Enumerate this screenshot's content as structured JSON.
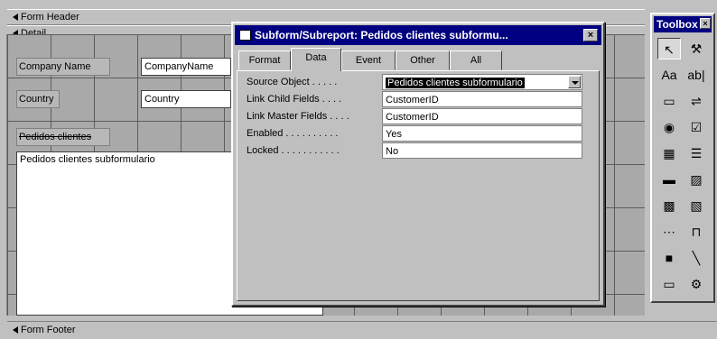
{
  "designer": {
    "form_header": "Form Header",
    "detail": "Detail",
    "form_footer": "Form Footer",
    "controls": {
      "company_label": "Company Name",
      "company_field": "CompanyName",
      "country_label": "Country",
      "country_field": "Country",
      "subform_label": "Pedidos clientes",
      "subform_text": "Pedidos clientes subformulario"
    }
  },
  "dialog": {
    "title": "Subform/Subreport: Pedidos clientes subformu...",
    "close_glyph": "×",
    "tabs": [
      {
        "label": "Format",
        "active": false
      },
      {
        "label": "Data",
        "active": true
      },
      {
        "label": "Event",
        "active": false
      },
      {
        "label": "Other",
        "active": false
      },
      {
        "label": "All",
        "active": false
      }
    ],
    "properties": [
      {
        "label": "Source Object . . . . .",
        "value": "Pedidos clientes subformulario"
      },
      {
        "label": "Link Child Fields . . . .",
        "value": "CustomerID"
      },
      {
        "label": "Link Master Fields . . . .",
        "value": "CustomerID"
      },
      {
        "label": "Enabled . . . . . . . . . .",
        "value": "Yes"
      },
      {
        "label": "Locked . . . . . . . . . . .",
        "value": "No"
      }
    ]
  },
  "toolbox": {
    "title": "Toolbox",
    "close_glyph": "×",
    "buttons": [
      {
        "icon": "select-objects-icon",
        "glyph": "↖"
      },
      {
        "icon": "control-wizards-icon",
        "glyph": "⚒"
      },
      {
        "icon": "label-icon",
        "glyph": "Aa"
      },
      {
        "icon": "text-box-icon",
        "glyph": "ab|"
      },
      {
        "icon": "option-group-icon",
        "glyph": "▭"
      },
      {
        "icon": "toggle-button-icon",
        "glyph": "⇌"
      },
      {
        "icon": "option-button-icon",
        "glyph": "◉"
      },
      {
        "icon": "check-box-icon",
        "glyph": "☑"
      },
      {
        "icon": "combo-box-icon",
        "glyph": "▦"
      },
      {
        "icon": "list-box-icon",
        "glyph": "☰"
      },
      {
        "icon": "command-button-icon",
        "glyph": "▬"
      },
      {
        "icon": "image-icon",
        "glyph": "▨"
      },
      {
        "icon": "unbound-object-frame-icon",
        "glyph": "▩"
      },
      {
        "icon": "bound-object-frame-icon",
        "glyph": "▧"
      },
      {
        "icon": "page-break-icon",
        "glyph": "⋯"
      },
      {
        "icon": "tab-control-icon",
        "glyph": "⊓"
      },
      {
        "icon": "subform-icon",
        "glyph": "■"
      },
      {
        "icon": "line-icon",
        "glyph": "╲"
      },
      {
        "icon": "rectangle-icon",
        "glyph": "▭"
      },
      {
        "icon": "more-controls-icon",
        "glyph": "⚙"
      }
    ]
  }
}
